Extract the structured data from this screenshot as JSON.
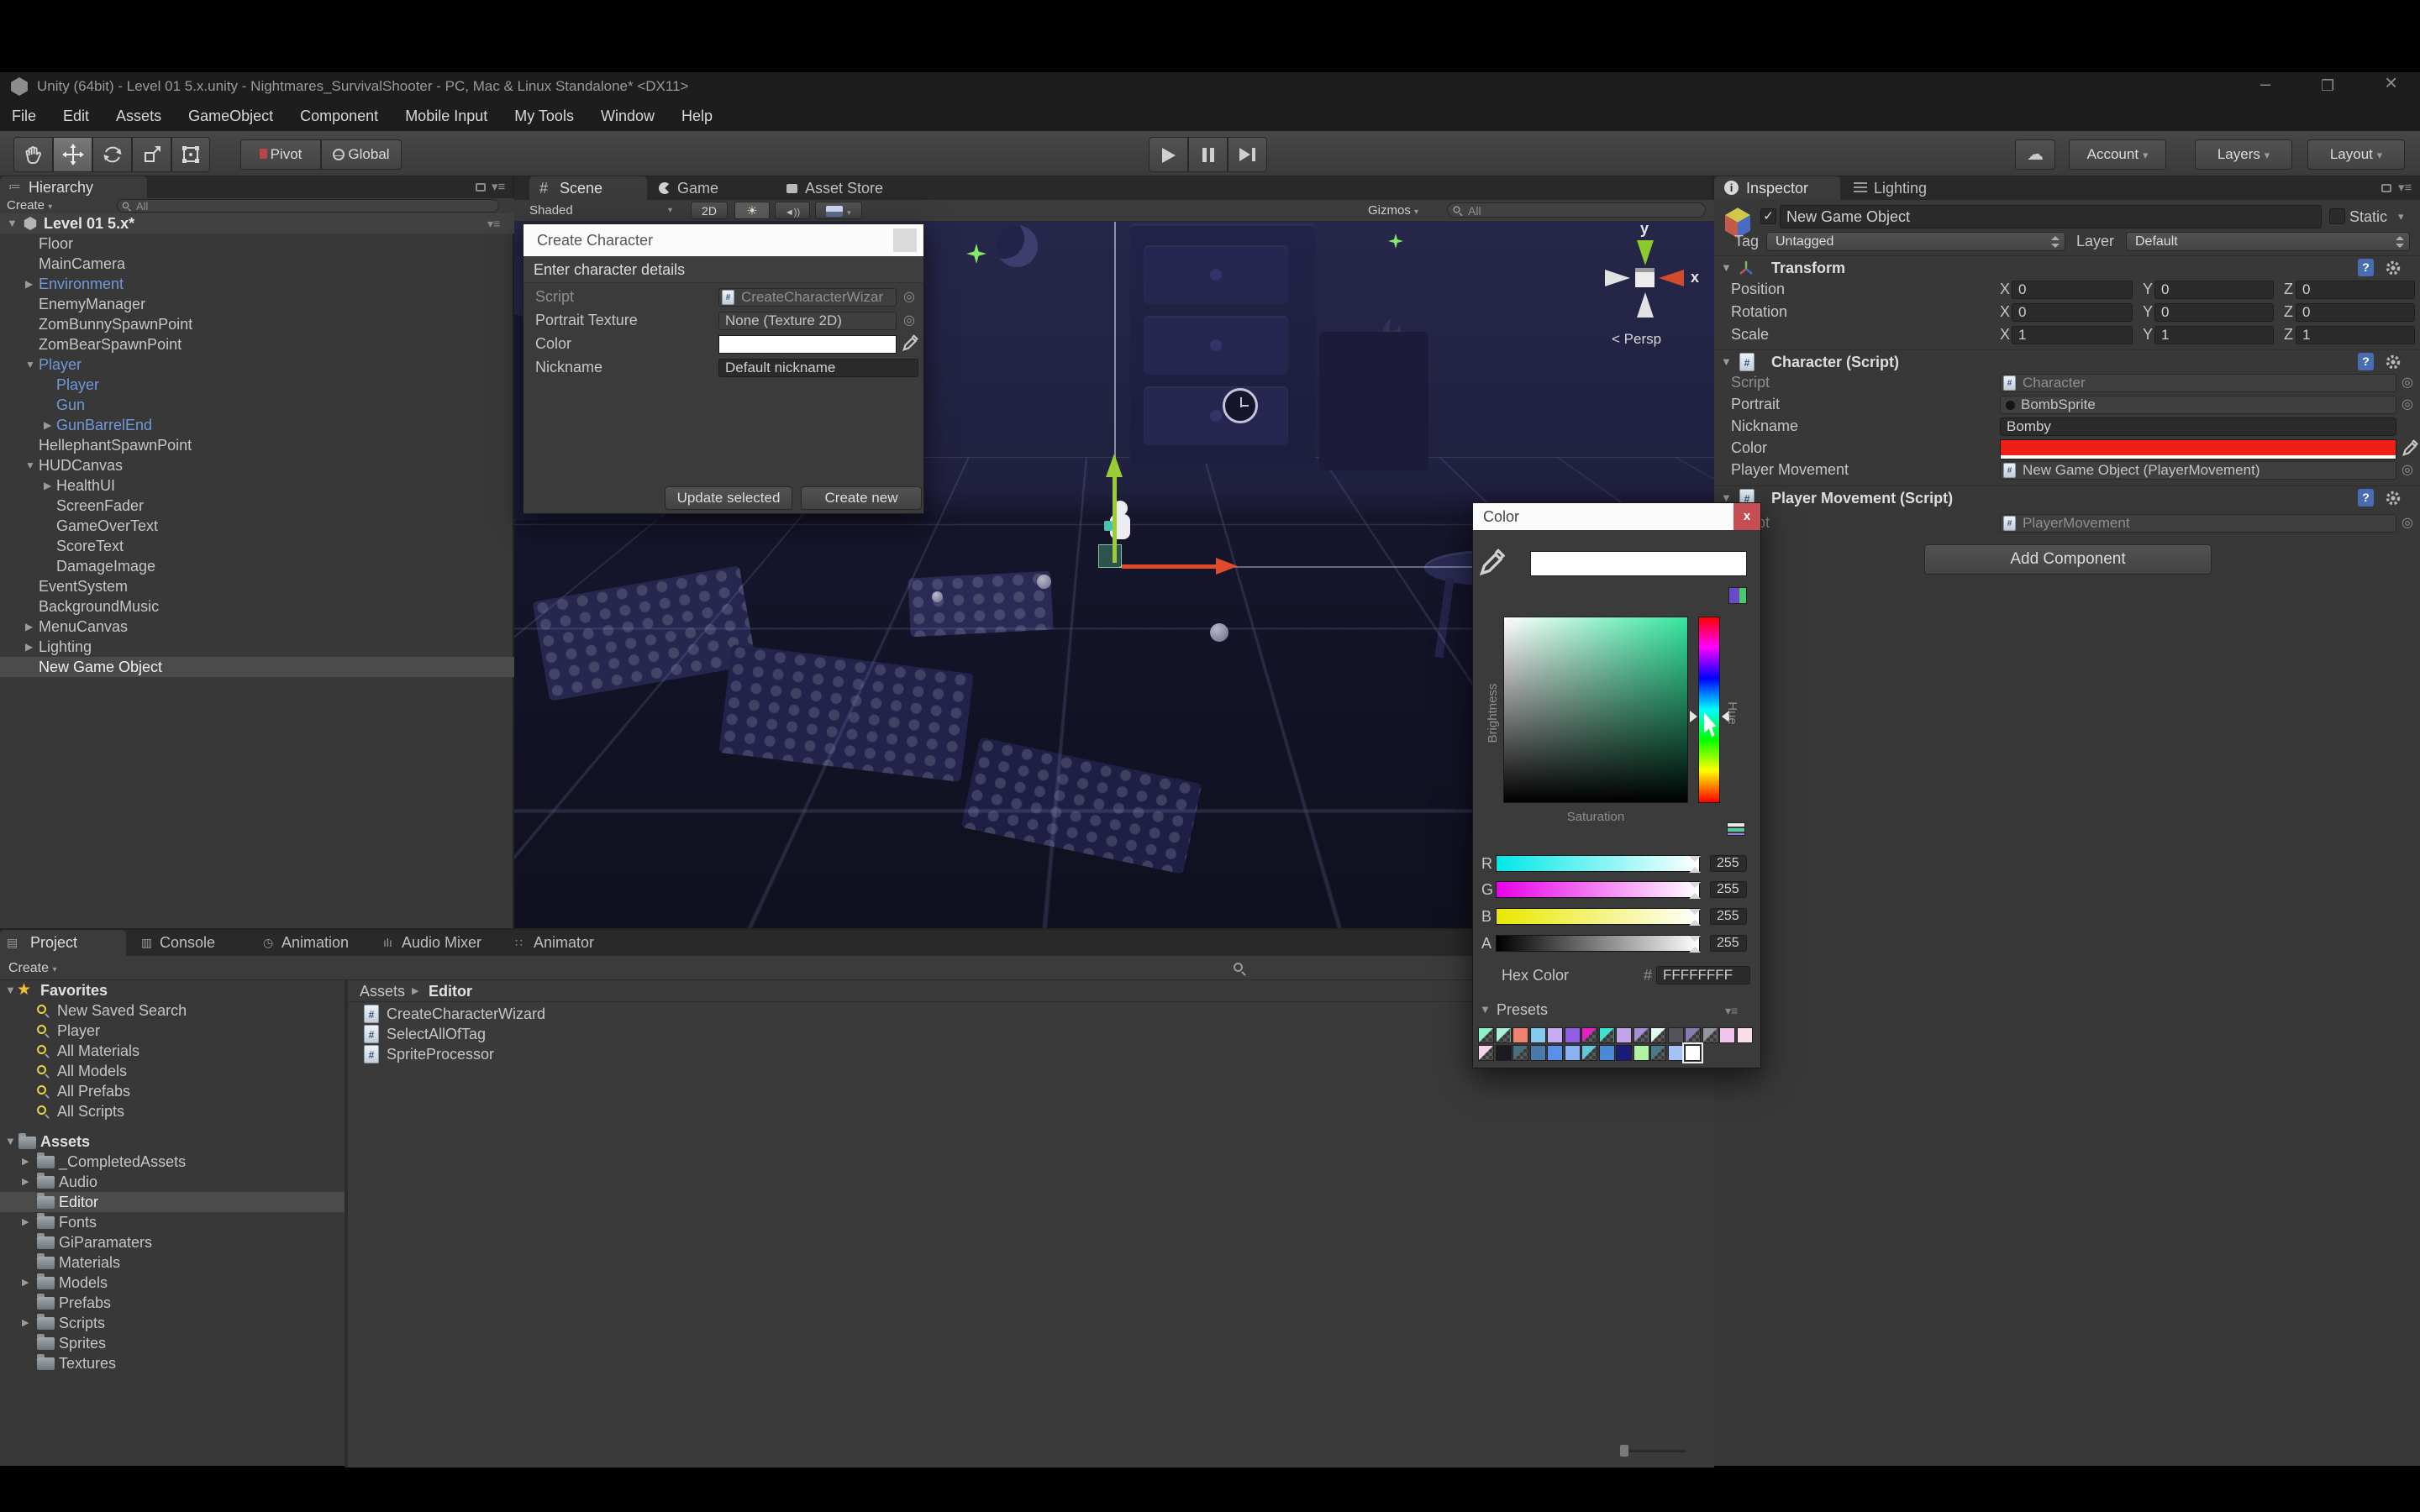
{
  "window": {
    "title": "Unity (64bit) - Level 01 5.x.unity - Nightmares_SurvivalShooter - PC, Mac & Linux Standalone* <DX11>",
    "controls": {
      "minimize": "–",
      "maximize": "❐",
      "close": "×"
    }
  },
  "menu": [
    "File",
    "Edit",
    "Assets",
    "GameObject",
    "Component",
    "Mobile Input",
    "My Tools",
    "Window",
    "Help"
  ],
  "toolbar": {
    "pivot": "Pivot",
    "global": "Global",
    "account": "Account",
    "layers": "Layers",
    "layout": "Layout"
  },
  "hierarchy": {
    "tab": "Hierarchy",
    "create": "Create",
    "search": "All",
    "scene_row": "Level 01 5.x*",
    "items": [
      {
        "label": "Floor",
        "indent": 1
      },
      {
        "label": "MainCamera",
        "indent": 1
      },
      {
        "label": "Environment",
        "indent": 1,
        "arrow": "right",
        "blue": true
      },
      {
        "label": "EnemyManager",
        "indent": 1
      },
      {
        "label": "ZomBunnySpawnPoint",
        "indent": 1
      },
      {
        "label": "ZomBearSpawnPoint",
        "indent": 1
      },
      {
        "label": "Player",
        "indent": 1,
        "arrow": "down",
        "blue": true
      },
      {
        "label": "Player",
        "indent": 2,
        "blue": true
      },
      {
        "label": "Gun",
        "indent": 2,
        "blue": true
      },
      {
        "label": "GunBarrelEnd",
        "indent": 2,
        "arrow": "right",
        "blue": true
      },
      {
        "label": "HellephantSpawnPoint",
        "indent": 1
      },
      {
        "label": "HUDCanvas",
        "indent": 1,
        "arrow": "down"
      },
      {
        "label": "HealthUI",
        "indent": 2,
        "arrow": "right"
      },
      {
        "label": "ScreenFader",
        "indent": 2
      },
      {
        "label": "GameOverText",
        "indent": 2
      },
      {
        "label": "ScoreText",
        "indent": 2
      },
      {
        "label": "DamageImage",
        "indent": 2
      },
      {
        "label": "EventSystem",
        "indent": 1
      },
      {
        "label": "BackgroundMusic",
        "indent": 1
      },
      {
        "label": "MenuCanvas",
        "indent": 1,
        "arrow": "right"
      },
      {
        "label": "Lighting",
        "indent": 1,
        "arrow": "right"
      },
      {
        "label": "New Game Object",
        "indent": 1,
        "selected": true
      }
    ]
  },
  "scene": {
    "tabs": [
      "Scene",
      "Game",
      "Asset Store"
    ],
    "shaded": "Shaded",
    "mode2d": "2D",
    "gizmos": "Gizmos",
    "search": "All",
    "persp": "Persp",
    "axis_y": "y",
    "axis_x": "x"
  },
  "wizard": {
    "title": "Create Character",
    "header": "Enter character details",
    "script_label": "Script",
    "script_value": "CreateCharacterWizar",
    "portrait_label": "Portrait Texture",
    "portrait_value": "None (Texture 2D)",
    "color_label": "Color",
    "nickname_label": "Nickname",
    "nickname_value": "Default nickname",
    "update_button": "Update selected",
    "create_button": "Create new"
  },
  "inspector": {
    "tab_inspector": "Inspector",
    "tab_lighting": "Lighting",
    "name": "New Game Object",
    "static": "Static",
    "tag_label": "Tag",
    "tag": "Untagged",
    "layer_label": "Layer",
    "layer": "Default",
    "transform": {
      "title": "Transform",
      "rows": [
        {
          "label": "Position",
          "x": "0",
          "y": "0",
          "z": "0"
        },
        {
          "label": "Rotation",
          "x": "0",
          "y": "0",
          "z": "0"
        },
        {
          "label": "Scale",
          "x": "1",
          "y": "1",
          "z": "1"
        }
      ]
    },
    "character": {
      "title": "Character (Script)",
      "script_label": "Script",
      "script": "Character",
      "portrait_label": "Portrait",
      "portrait": "BombSprite",
      "nickname_label": "Nickname",
      "nickname": "Bomby",
      "color_label": "Color",
      "color_value": "#ee1f14",
      "pm_label": "Player Movement",
      "pm": "New Game Object (PlayerMovement)"
    },
    "player_movement": {
      "title": "Player Movement (Script)",
      "script_label": "Script",
      "script": "PlayerMovement"
    },
    "add_component": "Add Component"
  },
  "color_picker": {
    "title": "Color",
    "current_color": "#ffffff",
    "hue_color": "#35e6a0",
    "brightness": "Brightness",
    "saturation": "Saturation",
    "hue": "Hue",
    "sliders": [
      {
        "label": "R",
        "value": "255",
        "from": "#00e8e8"
      },
      {
        "label": "G",
        "value": "255",
        "from": "#e800e8"
      },
      {
        "label": "B",
        "value": "255",
        "from": "#e8e800"
      },
      {
        "label": "A",
        "value": "255",
        "from": "#000000"
      }
    ],
    "hex_label": "Hex Color",
    "hex_hash": "#",
    "hex": "FFFFFFFF",
    "presets_label": "Presets",
    "presets_row1": [
      {
        "c": "#8df2c6",
        "chk": true
      },
      {
        "c": "#a8f2d8",
        "chk": true
      },
      {
        "c": "#ef8370"
      },
      {
        "c": "#84c9ee"
      },
      {
        "c": "#c9abf2"
      },
      {
        "c": "#8f5fe3"
      },
      {
        "c": "#e61fc3",
        "chk": true
      },
      {
        "c": "#3fe2cf",
        "chk": true
      },
      {
        "c": "#c3a3e9"
      },
      {
        "c": "#a58fd6",
        "chk": true
      },
      {
        "c": "#dffcf0",
        "chk": true
      },
      {
        "c": "#53535a"
      },
      {
        "c": "#8a7cae",
        "chk": true
      },
      {
        "c": "#95959d",
        "chk": true
      },
      {
        "c": "#f2c3ea"
      },
      {
        "c": "#fadde9"
      }
    ],
    "presets_row2": [
      {
        "c": "#f8d4ea",
        "chk": true
      },
      {
        "c": "#1b1b22"
      },
      {
        "c": "#476f7e",
        "chk": true
      },
      {
        "c": "#4a7aa8"
      },
      {
        "c": "#5a91e8"
      },
      {
        "c": "#8ab1f2"
      },
      {
        "c": "#60c9da",
        "chk": true
      },
      {
        "c": "#4a89d8"
      },
      {
        "c": "#1b1b79"
      },
      {
        "c": "#b2f2a3"
      },
      {
        "c": "#49798a",
        "chk": true
      },
      {
        "c": "#a3c2f8"
      },
      {
        "c": "#ffffff",
        "selected": true
      }
    ]
  },
  "project": {
    "tabs": [
      "Project",
      "Console",
      "Animation",
      "Audio Mixer",
      "Animator"
    ],
    "create": "Create",
    "favorites_label": "Favorites",
    "favorites": [
      "New Saved Search",
      "Player",
      "All Materials",
      "All Models",
      "All Prefabs",
      "All Scripts"
    ],
    "assets_label": "Assets",
    "folders": [
      {
        "name": "_CompletedAssets",
        "arrow": true
      },
      {
        "name": "Audio",
        "arrow": true
      },
      {
        "name": "Editor",
        "selected": true
      },
      {
        "name": "Fonts",
        "arrow": true
      },
      {
        "name": "GiParamaters"
      },
      {
        "name": "Materials"
      },
      {
        "name": "Models",
        "arrow": true
      },
      {
        "name": "Prefabs"
      },
      {
        "name": "Scripts",
        "arrow": true
      },
      {
        "name": "Sprites"
      },
      {
        "name": "Textures"
      }
    ],
    "breadcrumb_root": "Assets",
    "breadcrumb_current": "Editor",
    "files": [
      "CreateCharacterWizard",
      "SelectAllOfTag",
      "SpriteProcessor"
    ]
  }
}
